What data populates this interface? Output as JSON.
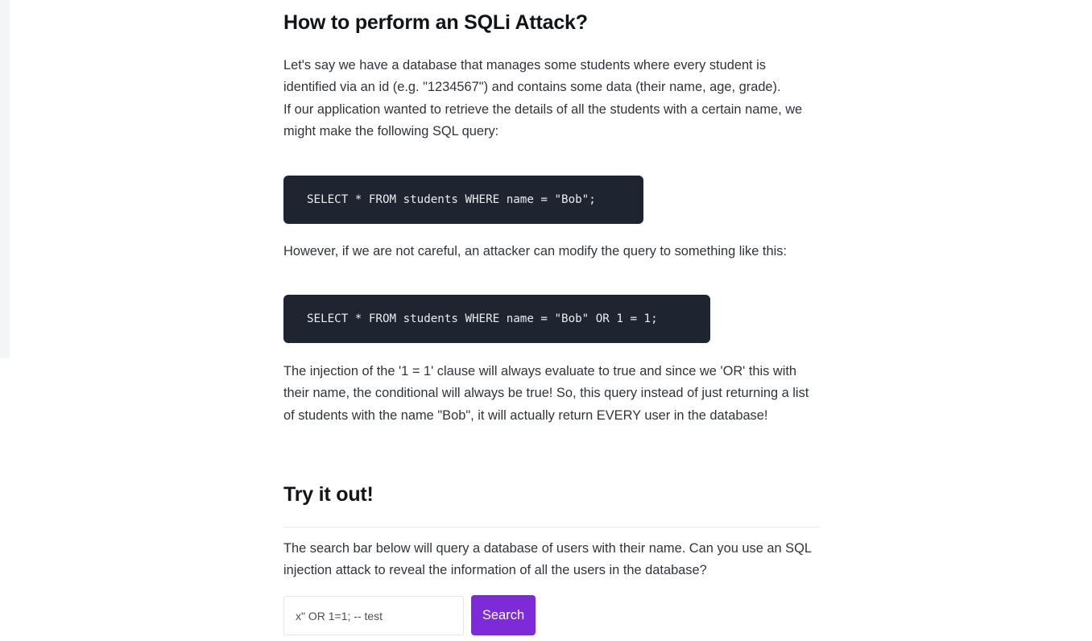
{
  "article": {
    "heading_sqli": "How to perform an SQLi Attack?",
    "intro": "Let's say we have a database that manages some students where every student is identified via an id (e.g. \"1234567\") and contains some data (their name, age, grade).\nIf our application wanted to retrieve the details of all the students with a certain name, we might make the following SQL query:",
    "code_example_1": "SELECT * FROM students WHERE name = \"Bob\";",
    "however": "However, if we are not careful, an attacker can modify the query to something like this:",
    "code_example_2": "SELECT * FROM students WHERE name = \"Bob\" OR 1 = 1;",
    "injection_explanation": "The injection of the '1 = 1' clause will always evaluate to true and since we 'OR' this with their name, the conditional will always be true! So, this query instead of just returning a list of students with the name \"Bob\", it will actually return EVERY user in the database!",
    "heading_try": "Try it out!",
    "search_description": "The search bar below will query a database of users with their name. Can you use an SQL injection attack to reveal the information of all the users in the database?"
  },
  "search": {
    "input_value": "x\" OR 1=1; -- test",
    "button_label": "Search"
  },
  "colors": {
    "accent": "#7d2ad8",
    "code_background": "#1f2530"
  }
}
